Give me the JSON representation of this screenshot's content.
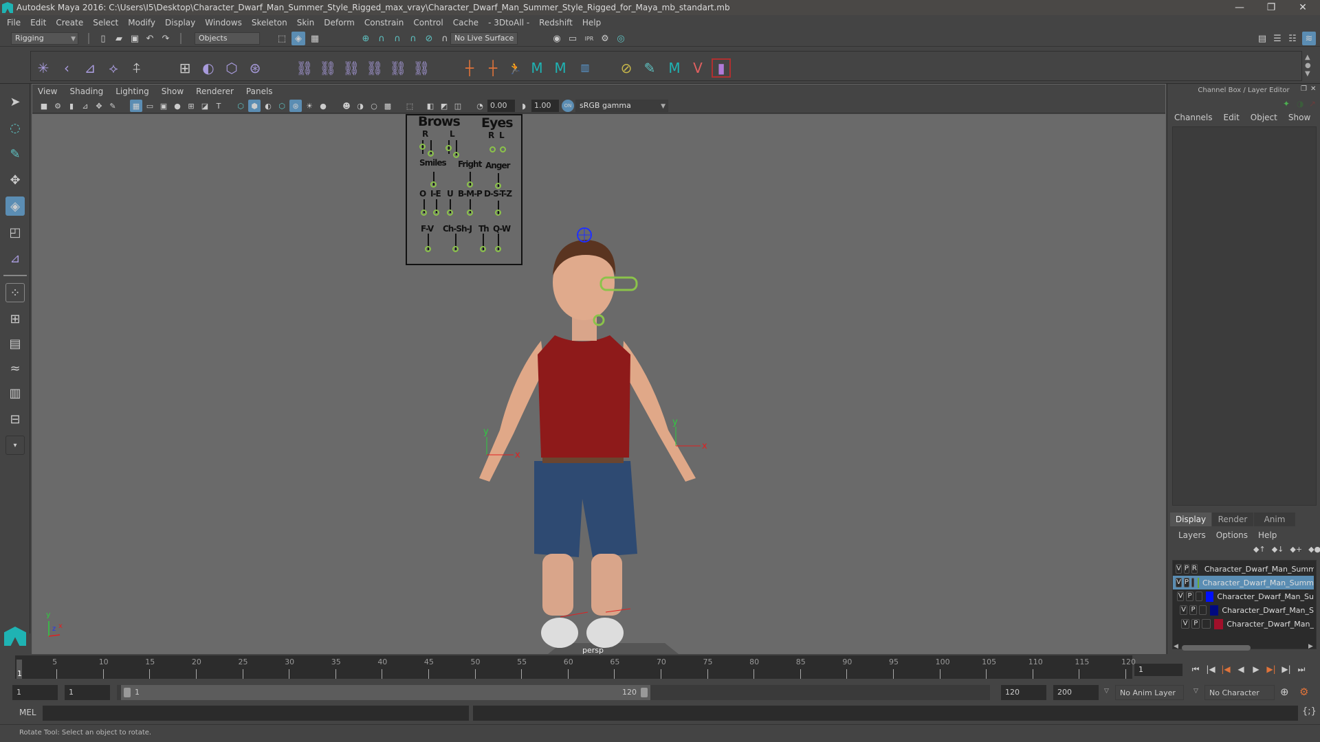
{
  "window": {
    "title": "Autodesk Maya 2016: C:\\Users\\I5\\Desktop\\Character_Dwarf_Man_Summer_Style_Rigged_max_vray\\Character_Dwarf_Man_Summer_Style_Rigged_for_Maya_mb_standart.mb",
    "minimize": "—",
    "restore": "❐",
    "close": "✕"
  },
  "menubar": [
    "File",
    "Edit",
    "Create",
    "Select",
    "Modify",
    "Display",
    "Windows",
    "Skeleton",
    "Skin",
    "Deform",
    "Constrain",
    "Control",
    "Cache",
    "- 3DtoAll -",
    "Redshift",
    "Help"
  ],
  "statusline": {
    "menuset": "Rigging",
    "selection_mode": "Objects",
    "live_surface": "No Live Surface"
  },
  "viewport": {
    "menu": [
      "View",
      "Shading",
      "Lighting",
      "Show",
      "Renderer",
      "Panels"
    ],
    "exposure": "0.00",
    "gamma": "1.00",
    "color_space": "sRGB gamma",
    "camera_label": "persp",
    "face_panel": {
      "brows": "Brows",
      "eyes": "Eyes",
      "r": "R",
      "l": "L",
      "smiles": "Smiles",
      "fright": "Fright",
      "anger": "Anger",
      "o": "O",
      "i_e": "I-E",
      "u": "U",
      "b_m_p": "B-M-P",
      "d_s_t_z": "D-S-T-Z",
      "f_v": "F-V",
      "ch_sh_j": "Ch-Sh-J",
      "th": "Th",
      "q_w": "Q-W"
    },
    "axis": {
      "x": "x",
      "y": "y",
      "z": "z"
    }
  },
  "channel_box": {
    "title": "Channel Box / Layer Editor",
    "menu": [
      "Channels",
      "Edit",
      "Object",
      "Show"
    ]
  },
  "layer_editor": {
    "tabs": [
      "Display",
      "Render",
      "Anim"
    ],
    "active_tab": "Display",
    "menu": [
      "Layers",
      "Options",
      "Help"
    ],
    "layers": [
      {
        "v": "V",
        "p": "P",
        "r": "R",
        "color": "#0a4a1e",
        "name": "Character_Dwarf_Man_Summ",
        "selected": false
      },
      {
        "v": "V",
        "p": "P",
        "r": "",
        "color": "#6aaa30",
        "name": "Character_Dwarf_Man_Summ",
        "selected": true
      },
      {
        "v": "V",
        "p": "P",
        "r": "",
        "color": "#0010ff",
        "name": "Character_Dwarf_Man_Su",
        "selected": false
      },
      {
        "v": "V",
        "p": "P",
        "r": "",
        "color": "#000a80",
        "name": "Character_Dwarf_Man_S",
        "selected": false
      },
      {
        "v": "V",
        "p": "P",
        "r": "",
        "color": "#a0102a",
        "name": "Character_Dwarf_Man_",
        "selected": false
      }
    ]
  },
  "timeline": {
    "ticks": [
      5,
      10,
      15,
      20,
      25,
      30,
      35,
      40,
      45,
      50,
      55,
      60,
      65,
      70,
      75,
      80,
      85,
      90,
      95,
      100,
      105,
      110,
      115,
      120
    ],
    "range_min": 1,
    "range_max": 120,
    "current_frame_marker": "1",
    "current_frame": "1"
  },
  "range": {
    "start": "1",
    "playback_start": "1",
    "slider_start": "1",
    "slider_end": "120",
    "playback_end": "120",
    "end": "200",
    "anim_layer": "No Anim Layer",
    "character_set": "No Character Set"
  },
  "command_line": {
    "label": "MEL"
  },
  "help_line": "Rotate Tool: Select an object to rotate."
}
